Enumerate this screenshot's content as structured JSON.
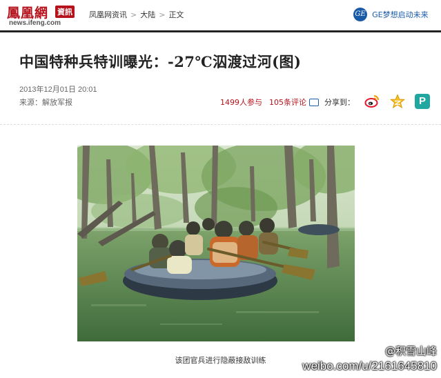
{
  "brand": {
    "logo_text": "鳳凰網",
    "logo_badge": "資訊",
    "logo_url": "news.ifeng.com"
  },
  "breadcrumb": [
    "凤凰网资讯",
    "大陆",
    "正文"
  ],
  "breadcrumb_sep": ">",
  "ad": {
    "mark": "GE",
    "text": "GE梦想启动未来"
  },
  "article": {
    "title": "中国特种兵特训曝光：-27℃泅渡过河(图)",
    "date": "2013年12月01日 20:01",
    "source": "来源：解放军报",
    "participants": "1499人参与",
    "comments": "105条评论",
    "share_label": "分享到：",
    "caption": "该团官兵进行隐蔽接敌训练"
  },
  "share_icons": [
    "weibo-icon",
    "qzone-star-icon",
    "pinterest-icon"
  ],
  "share_pinterest_glyph": "P",
  "watermark": {
    "handle": "@积雪山峰",
    "url": "weibo.com/u/2161645810"
  },
  "colors": {
    "brand_red": "#b5121b",
    "link_blue": "#1a5ba8",
    "water_green": "#5e8a4a"
  }
}
